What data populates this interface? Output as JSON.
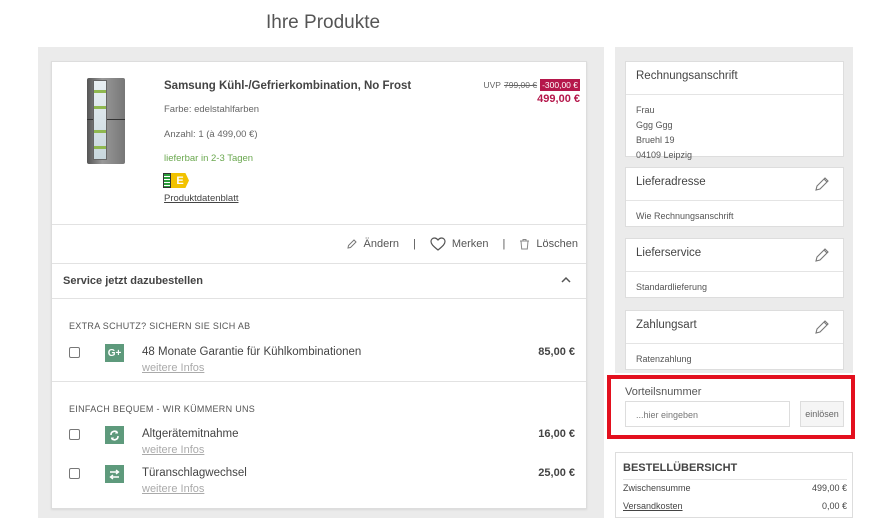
{
  "page": {
    "title": "Ihre Produkte"
  },
  "product": {
    "name": "Samsung Kühl-/Gefrierkombination, No Frost",
    "color": "Farbe: edelstahlfarben",
    "quantity": "Anzahl: 1 (à 499,00 €)",
    "availability": "lieferbar in 2-3 Tagen",
    "energy_class": "E",
    "datasheet_link": "Produktdatenblatt",
    "uvp_label": "UVP",
    "uvp_price": "799,00 €",
    "discount": "-300,00 €",
    "price": "499,00 €"
  },
  "actions": {
    "edit": "Ändern",
    "remember": "Merken",
    "delete": "Löschen",
    "separator": "|"
  },
  "services": {
    "header": "Service jetzt dazubestellen",
    "categories": [
      {
        "title": "EXTRA SCHUTZ? SICHERN SIE SICH AB",
        "items": [
          {
            "icon_text": "G+",
            "name": "48 Monate Garantie für Kühlkombinationen",
            "link": "weitere Infos",
            "price": "85,00 €"
          }
        ]
      },
      {
        "title": "EINFACH BEQUEM - WIR KÜMMERN UNS",
        "items": [
          {
            "icon_text": "",
            "name": "Altgerätemitnahme",
            "link": "weitere Infos",
            "price": "16,00 €"
          },
          {
            "icon_text": "",
            "name": "Türanschlagwechsel",
            "link": "weitere Infos",
            "price": "25,00 €"
          }
        ]
      }
    ]
  },
  "billing": {
    "title": "Rechnungsanschrift",
    "line1": "Frau",
    "line2": "Ggg Ggg",
    "line3": "Bruehl 19",
    "line4": "04109 Leipzig"
  },
  "shipping": {
    "title": "Lieferadresse",
    "value": "Wie Rechnungsanschrift"
  },
  "delivery": {
    "title": "Lieferservice",
    "value": "Standardlieferung"
  },
  "payment": {
    "title": "Zahlungsart",
    "value": "Ratenzahlung"
  },
  "voucher": {
    "label": "Vorteilsnummer",
    "placeholder": "...hier eingeben",
    "button": "einlösen"
  },
  "summary": {
    "title": "BESTELLÜBERSICHT",
    "subtotal_label": "Zwischensumme",
    "subtotal": "499,00 €",
    "shipping_label": "Versandkosten",
    "shipping": "0,00 €"
  },
  "colors": {
    "accent": "#b5174b",
    "highlight": "#e3101e",
    "available": "#6aa84f",
    "service_icon": "#5e9a7c"
  }
}
